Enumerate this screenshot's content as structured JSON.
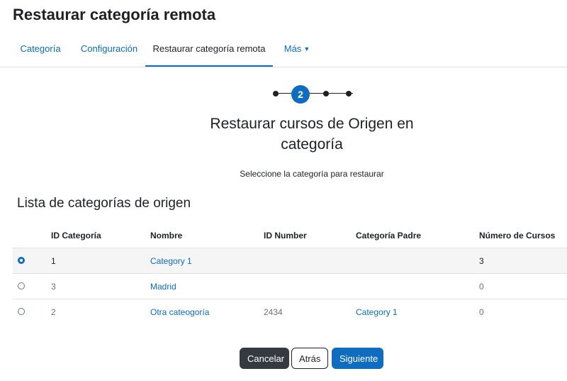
{
  "page": {
    "title": "Restaurar categoría remota"
  },
  "tabs": [
    {
      "label": "Categoría"
    },
    {
      "label": "Configuración"
    },
    {
      "label": "Restaurar categoría remota"
    },
    {
      "label": "Más"
    }
  ],
  "stepper": {
    "current_step": "2",
    "total_steps": 4,
    "current_index": 2
  },
  "section": {
    "heading": "Restaurar cursos de Origen en categoría",
    "subtitle": "Seleccione la categoría para restaurar"
  },
  "list": {
    "heading": "Lista de categorías de origen",
    "columns": [
      "ID Categoría",
      "Nombre",
      "ID Number",
      "Categoría Padre",
      "Número de Cursos"
    ],
    "rows": [
      {
        "selected": true,
        "id": "1",
        "name": "Category 1",
        "id_number": "",
        "parent": "",
        "courses": "3"
      },
      {
        "selected": false,
        "id": "3",
        "name": "Madrid",
        "id_number": "",
        "parent": "",
        "courses": "0"
      },
      {
        "selected": false,
        "id": "2",
        "name": "Otra cateogoría",
        "id_number": "2434",
        "parent": "Category 1",
        "courses": "0"
      }
    ]
  },
  "buttons": {
    "cancel": "Cancelar",
    "back": "Atrás",
    "next": "Siguiente"
  },
  "colors": {
    "accent": "#0f6cbf",
    "text": "#1d2125",
    "muted": "#6a737b",
    "dark_button": "#343a40"
  }
}
